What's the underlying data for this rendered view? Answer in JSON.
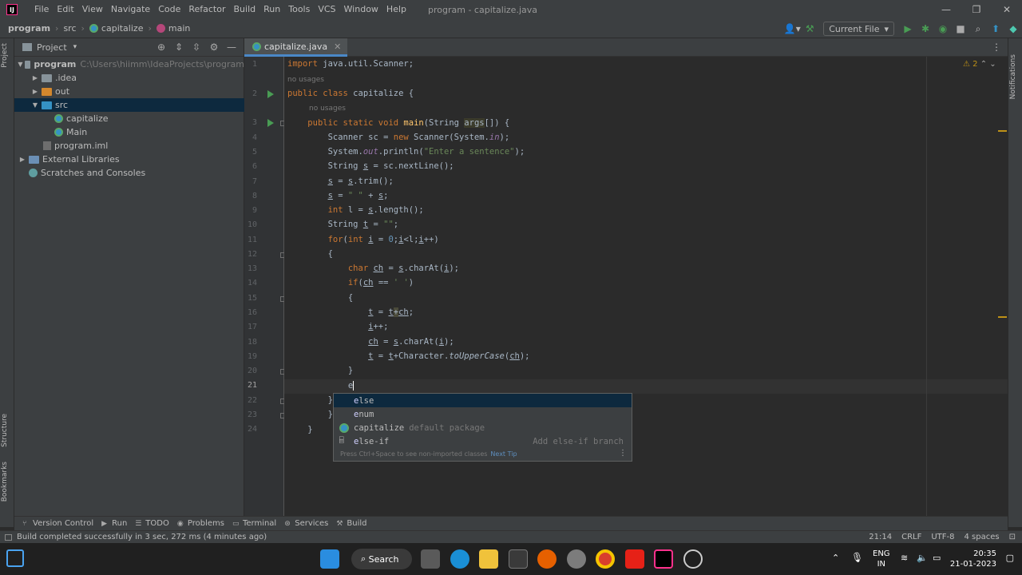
{
  "app": {
    "logo_text": "IJ",
    "window_title": "program - capitalize.java",
    "menu": [
      "File",
      "Edit",
      "View",
      "Navigate",
      "Code",
      "Refactor",
      "Build",
      "Run",
      "Tools",
      "VCS",
      "Window",
      "Help"
    ]
  },
  "breadcrumb": [
    "program",
    "src",
    "capitalize",
    "main"
  ],
  "run_config": "Current File",
  "project_panel": {
    "title": "Project",
    "tree": [
      {
        "label": "program",
        "hint": "C:\\Users\\hiimm\\IdeaProjects\\program",
        "level": 0,
        "expanded": true,
        "kind": "folder"
      },
      {
        "label": ".idea",
        "level": 1,
        "expanded": false,
        "kind": "folder"
      },
      {
        "label": "out",
        "level": 1,
        "expanded": false,
        "kind": "folder-orange"
      },
      {
        "label": "src",
        "level": 1,
        "expanded": true,
        "kind": "folder-blue",
        "selected": true
      },
      {
        "label": "capitalize",
        "level": 2,
        "kind": "java"
      },
      {
        "label": "Main",
        "level": 2,
        "kind": "java"
      },
      {
        "label": "program.iml",
        "level": 1,
        "kind": "iml"
      },
      {
        "label": "External Libraries",
        "level": 0,
        "expanded": false,
        "kind": "lib"
      },
      {
        "label": "Scratches and Consoles",
        "level": 0,
        "kind": "scratch"
      }
    ]
  },
  "editor": {
    "tab": "capitalize.java",
    "warnings": "2",
    "usage_hint": "no usages",
    "current_line": 21
  },
  "completion": {
    "items": [
      {
        "match": "e",
        "rest": "lse",
        "dim": "",
        "right": ""
      },
      {
        "match": "e",
        "rest": "num",
        "dim": "",
        "right": ""
      },
      {
        "match": "",
        "rest": "capitalize",
        "dim": "default package",
        "right": ""
      },
      {
        "match": "e",
        "rest": "lse-if",
        "dim": "",
        "right": "Add else-if branch"
      }
    ],
    "footer": "Press Ctrl+Space to see non-imported classes",
    "next_tip": "Next Tip"
  },
  "stripes": {
    "left_top": "Project",
    "left_mid": "Structure",
    "left_bottom": "Bookmarks",
    "right": "Notifications"
  },
  "bottom_tools": [
    "Version Control",
    "Run",
    "TODO",
    "Problems",
    "Terminal",
    "Services",
    "Build"
  ],
  "status": {
    "message": "Build completed successfully in 3 sec, 272 ms (4 minutes ago)",
    "position": "21:14",
    "line_sep": "CRLF",
    "encoding": "UTF-8",
    "indent": "4 spaces"
  },
  "taskbar": {
    "search": "Search",
    "lang_top": "ENG",
    "lang_bottom": "IN",
    "time": "20:35",
    "date": "21-01-2023"
  }
}
